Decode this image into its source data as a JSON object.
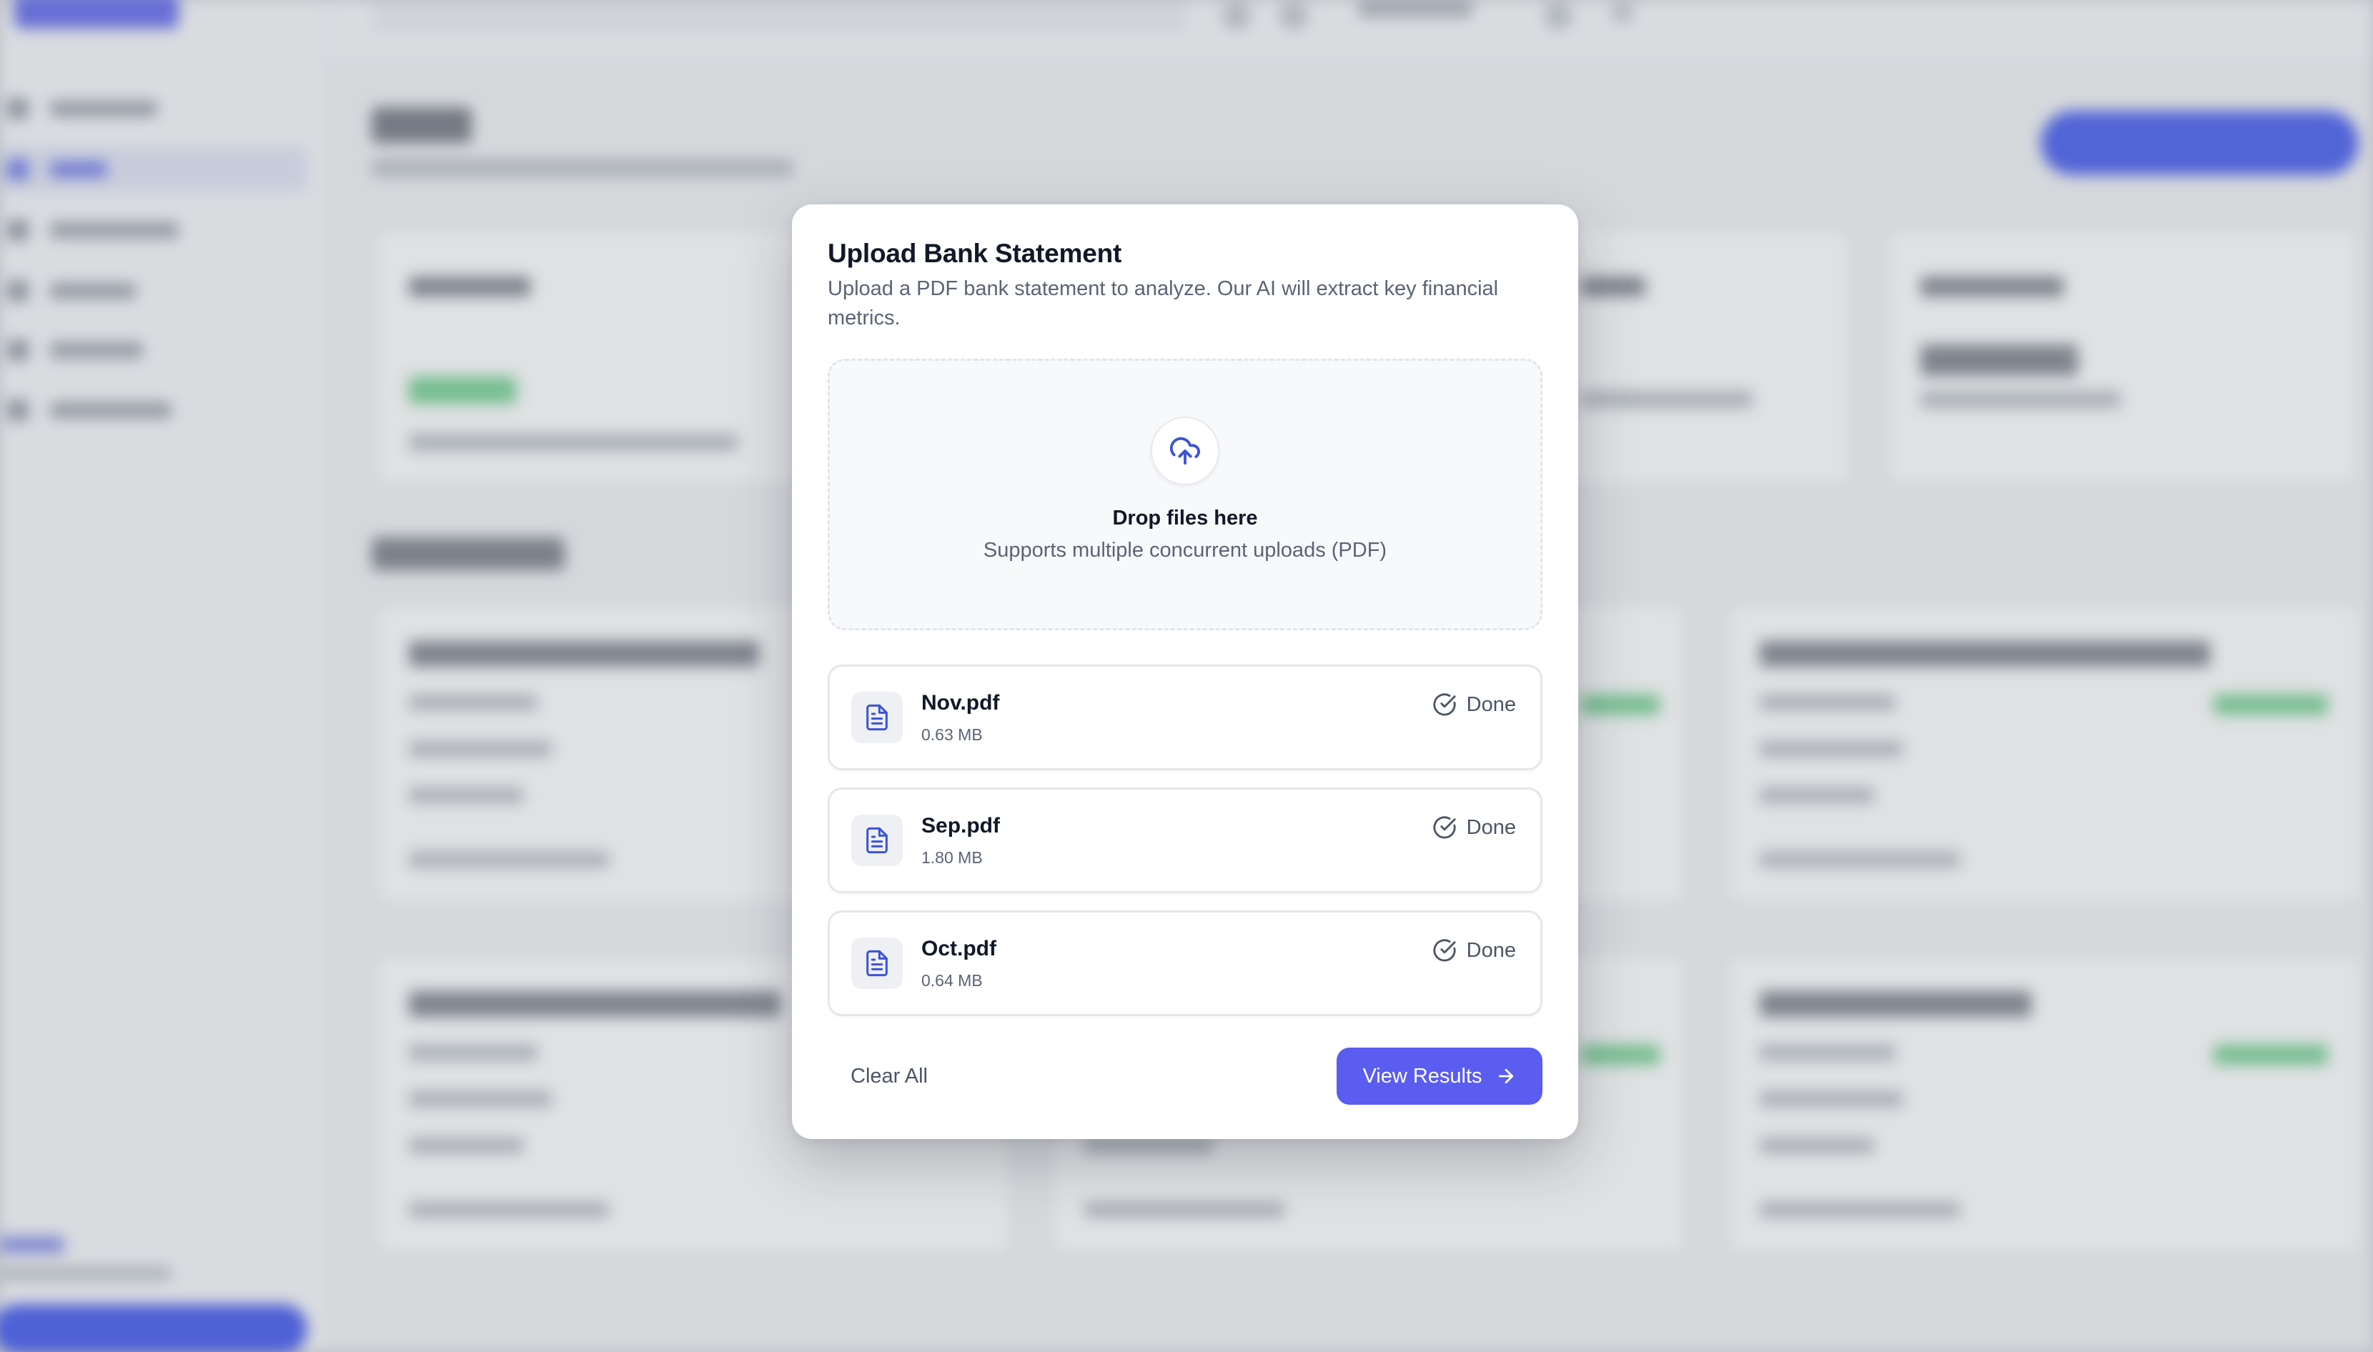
{
  "modal": {
    "title": "Upload Bank Statement",
    "description": "Upload a PDF bank statement to analyze. Our AI will extract key financial metrics.",
    "dropzone": {
      "icon": "cloud-upload-icon",
      "title": "Drop files here",
      "subtitle": "Supports multiple concurrent uploads (PDF)"
    },
    "files": [
      {
        "name": "Nov.pdf",
        "size": "0.63 MB",
        "status": "Done"
      },
      {
        "name": "Sep.pdf",
        "size": "1.80 MB",
        "status": "Done"
      },
      {
        "name": "Oct.pdf",
        "size": "0.64 MB",
        "status": "Done"
      }
    ],
    "footer": {
      "clear_label": "Clear All",
      "primary_label": "View Results"
    }
  },
  "colors": {
    "accent": "#5b5cf0",
    "icon_blue": "#3b53d6",
    "overlay": "#d3d5da"
  }
}
